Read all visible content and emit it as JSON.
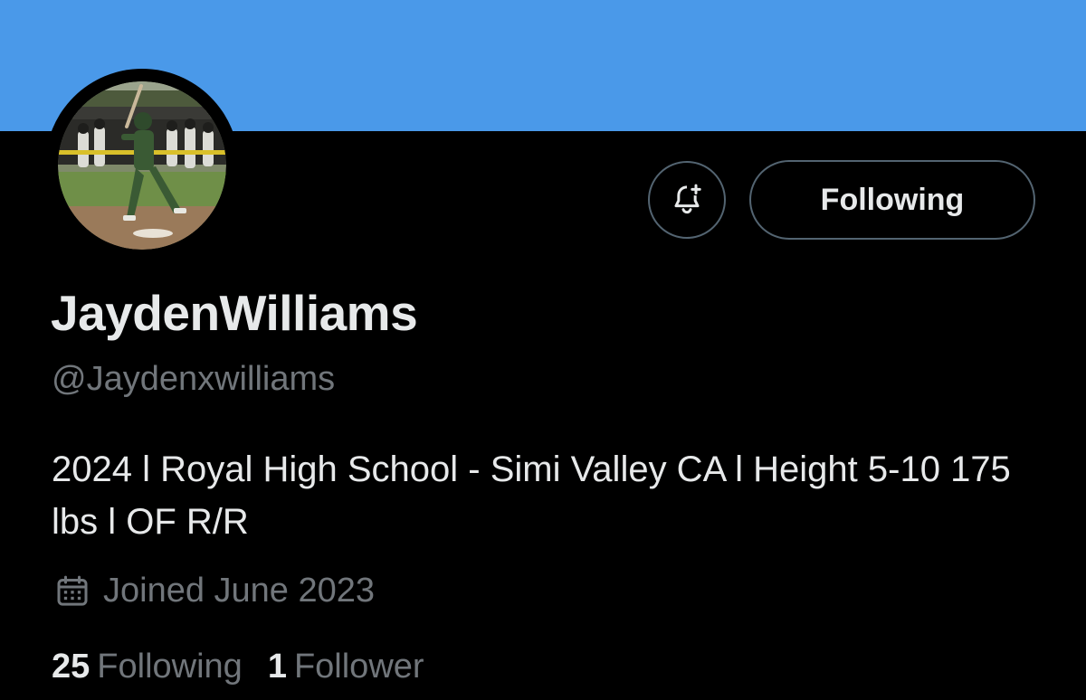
{
  "profile": {
    "display_name": "JaydenWilliams",
    "handle": "@Jaydenxwilliams",
    "bio": "2024 l Royal High School - Simi Valley CA l Height 5-10 175 lbs l OF R/R",
    "joined": "Joined June 2023"
  },
  "actions": {
    "notify_icon": "bell-plus-icon",
    "following_label": "Following"
  },
  "stats": {
    "following_count": "25",
    "following_label": "Following",
    "followers_count": "1",
    "followers_label": "Follower"
  },
  "colors": {
    "banner": "#4a99e9",
    "background": "#000000",
    "primary_text": "#e7e9ea",
    "secondary_text": "#71767b",
    "button_border": "#536471"
  }
}
